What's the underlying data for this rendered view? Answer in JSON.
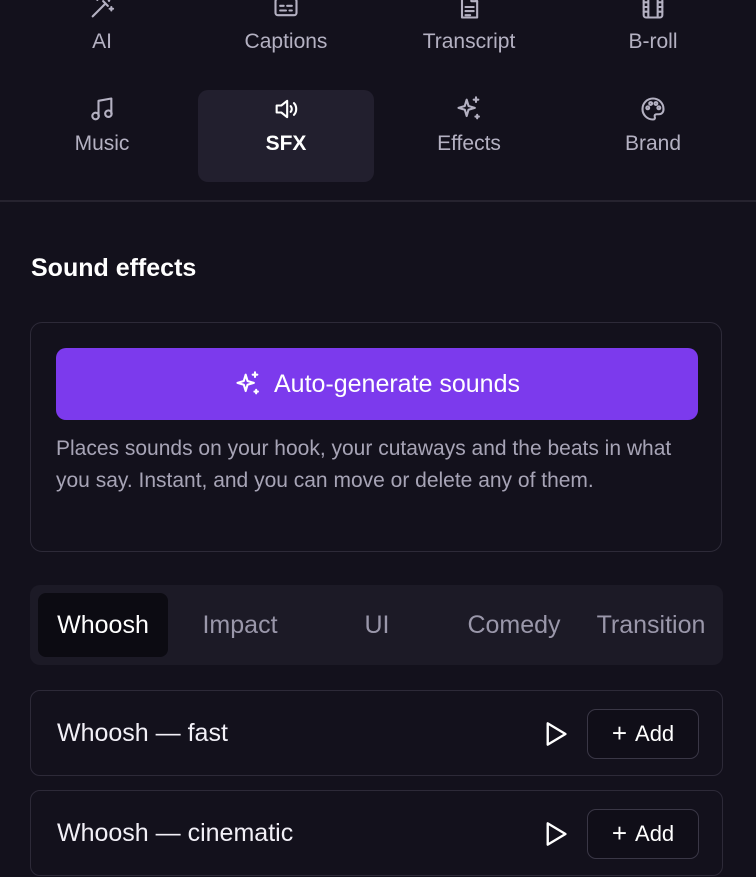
{
  "tools": [
    {
      "label": "AI",
      "icon": "magic-wand-icon"
    },
    {
      "label": "Captions",
      "icon": "captions-icon"
    },
    {
      "label": "Transcript",
      "icon": "document-icon"
    },
    {
      "label": "B-roll",
      "icon": "film-icon"
    },
    {
      "label": "Music",
      "icon": "music-note-icon"
    },
    {
      "label": "SFX",
      "icon": "speaker-icon",
      "active": true
    },
    {
      "label": "Effects",
      "icon": "sparkles-icon"
    },
    {
      "label": "Brand",
      "icon": "palette-icon"
    }
  ],
  "section": {
    "title": "Sound effects",
    "auto_button_label": "Auto-generate sounds",
    "auto_button_icon": "sparkles-icon",
    "description": "Places sounds on your hook, your cutaways and the beats in what you say. Instant, and you can move or delete any of them."
  },
  "categories": [
    {
      "label": "Whoosh",
      "active": true
    },
    {
      "label": "Impact"
    },
    {
      "label": "UI"
    },
    {
      "label": "Comedy"
    },
    {
      "label": "Transition"
    }
  ],
  "sounds": [
    {
      "name": "Whoosh — fast",
      "add_label": "Add"
    },
    {
      "name": "Whoosh — cinematic",
      "add_label": "Add"
    }
  ],
  "colors": {
    "background": "#13111c",
    "accent": "#7c3aed",
    "active_tool_bg": "#221f2e"
  }
}
